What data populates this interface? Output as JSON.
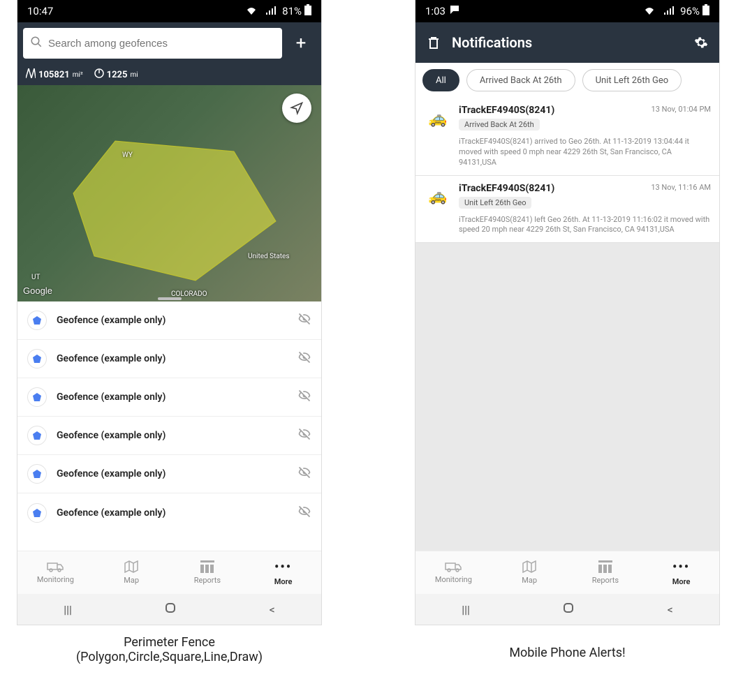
{
  "statusbar_left": {
    "time": "10:47",
    "wifi": "📶",
    "signal": "📡",
    "battery_pct": "81%",
    "battery_icon": "▮"
  },
  "statusbar_right": {
    "time": "1:03",
    "msg_icon": "💬",
    "wifi": "📶",
    "signal": "📡",
    "battery_pct": "96%",
    "battery_icon": "▮"
  },
  "geo_header": {
    "search_placeholder": "Search among geofences",
    "plus": "+"
  },
  "stats": {
    "area": "105821",
    "area_unit": "mi²",
    "perimeter": "1225",
    "perimeter_unit": "mi"
  },
  "map": {
    "label_wy": "WY",
    "label_co": "COLORADO",
    "label_us": "United States",
    "label_ut": "UT",
    "google": "Google"
  },
  "geofences": [
    {
      "label": "Geofence (example only)"
    },
    {
      "label": "Geofence (example only)"
    },
    {
      "label": "Geofence (example only)"
    },
    {
      "label": "Geofence (example only)"
    },
    {
      "label": "Geofence (example only)"
    },
    {
      "label": "Geofence (example only)"
    }
  ],
  "nav": {
    "monitoring": "Monitoring",
    "map": "Map",
    "reports": "Reports",
    "more": "More"
  },
  "notif_header": {
    "title": "Notifications"
  },
  "chips": {
    "all": "All",
    "c1": "Arrived Back At 26th",
    "c2": "Unit Left 26th Geo"
  },
  "notifs": [
    {
      "title": "iTrackEF4940S(8241)",
      "tag": "Arrived Back At 26th",
      "time": "13 Nov, 01:04 PM",
      "desc": "iTrackEF4940S(8241) arrived to Geo 26th.    At 11-13-2019 13:04:44 it moved with speed 0 mph near 4229 26th St, San Francisco, CA 94131,USA"
    },
    {
      "title": "iTrackEF4940S(8241)",
      "tag": "Unit Left 26th Geo",
      "time": "13 Nov, 11:16 AM",
      "desc": "iTrackEF4940S(8241) left Geo 26th.    At 11-13-2019 11:16:02 it moved with speed 20 mph near 4229 26th St, San Francisco, CA 94131,USA"
    }
  ],
  "captions": {
    "left_l1": "Perimeter Fence",
    "left_l2": "(Polygon,Circle,Square,Line,Draw)",
    "right": "Mobile Phone Alerts!"
  }
}
